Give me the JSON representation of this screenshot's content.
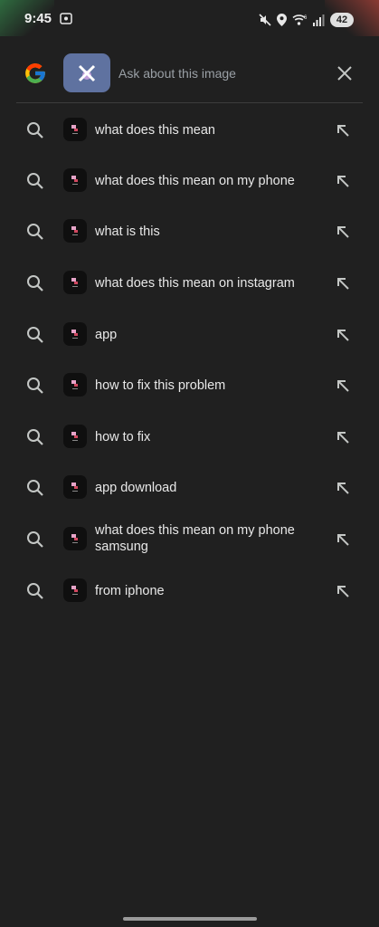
{
  "status_bar": {
    "time": "9:45",
    "battery": "42",
    "icons": [
      "screen-record-icon",
      "mute-icon",
      "location-icon",
      "wifi-icon",
      "signal-icon"
    ]
  },
  "search": {
    "placeholder": "Ask about this image",
    "icons": [
      "google-logo-icon",
      "image-thumbnail",
      "close-icon"
    ]
  },
  "suggestions": [
    "what does this mean",
    "what does this mean on my phone",
    "what is this",
    "what does this mean on instagram",
    "app",
    "how to fix this problem",
    "how to fix",
    "app download",
    "what does this mean on my phone samsung",
    "from iphone"
  ],
  "colors": {
    "background": "#202020",
    "text": "#e8e8e8",
    "placeholder": "#9aa0a6",
    "thumbnail": "#5f72a0"
  }
}
